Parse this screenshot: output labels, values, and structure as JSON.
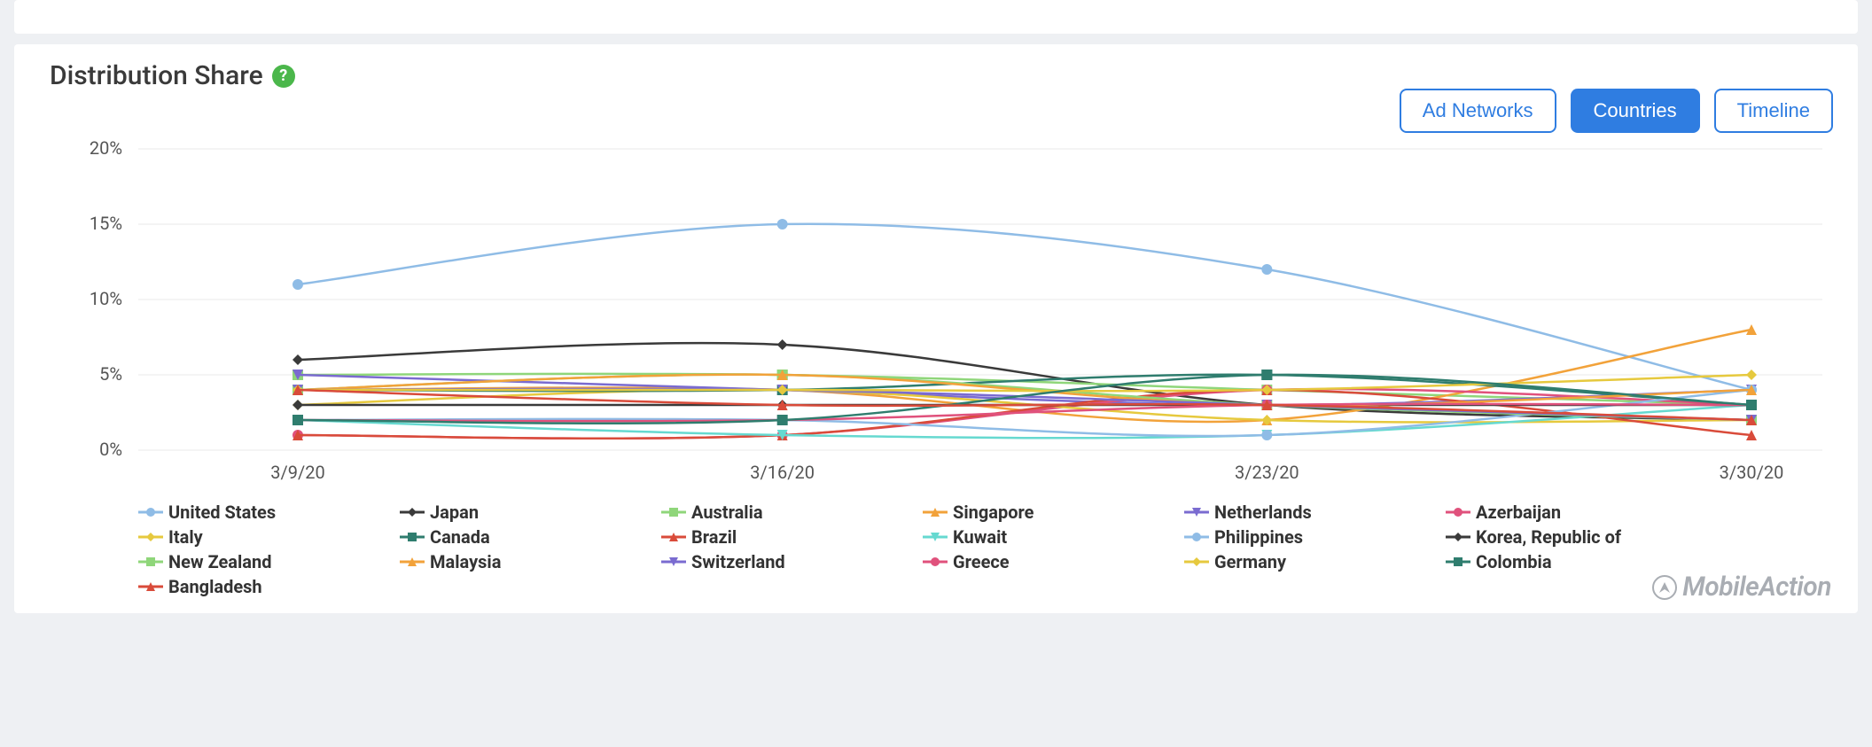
{
  "header": {
    "title": "Distribution Share"
  },
  "buttons": {
    "ad_networks": "Ad Networks",
    "countries": "Countries",
    "timeline": "Timeline"
  },
  "brand": "MobileAction",
  "chart_data": {
    "type": "line",
    "title": "Distribution Share",
    "xlabel": "",
    "ylabel": "",
    "ylim": [
      0,
      20
    ],
    "y_ticks": [
      0,
      5,
      10,
      15,
      20
    ],
    "y_tick_labels": [
      "0%",
      "5%",
      "10%",
      "15%",
      "20%"
    ],
    "categories": [
      "3/9/20",
      "3/16/20",
      "3/23/20",
      "3/30/20"
    ],
    "series": [
      {
        "name": "United States",
        "color": "#8fbce6",
        "marker": "circle",
        "values": [
          11,
          15,
          12,
          4
        ]
      },
      {
        "name": "Japan",
        "color": "#3a3a3a",
        "marker": "diamond",
        "values": [
          6,
          7,
          3,
          2
        ]
      },
      {
        "name": "Australia",
        "color": "#8fd67a",
        "marker": "square",
        "values": [
          5,
          5,
          4,
          3
        ]
      },
      {
        "name": "Singapore",
        "color": "#f2a23a",
        "marker": "triangle-up",
        "values": [
          4,
          4,
          2,
          8
        ]
      },
      {
        "name": "Netherlands",
        "color": "#7a6bd0",
        "marker": "triangle-down",
        "values": [
          5,
          4,
          3,
          4
        ]
      },
      {
        "name": "Azerbaijan",
        "color": "#e0517c",
        "marker": "circle",
        "values": [
          1,
          1,
          4,
          3
        ]
      },
      {
        "name": "Italy",
        "color": "#e6c93e",
        "marker": "diamond",
        "values": [
          3,
          4,
          2,
          2
        ]
      },
      {
        "name": "Canada",
        "color": "#2f7d6e",
        "marker": "square",
        "values": [
          4,
          4,
          5,
          3
        ]
      },
      {
        "name": "Brazil",
        "color": "#d94b3a",
        "marker": "triangle-up",
        "values": [
          1,
          1,
          4,
          1
        ]
      },
      {
        "name": "Kuwait",
        "color": "#66d9d0",
        "marker": "triangle-down",
        "values": [
          2,
          1,
          1,
          3
        ]
      },
      {
        "name": "Philippines",
        "color": "#8fbce6",
        "marker": "circle",
        "values": [
          2,
          2,
          1,
          4
        ]
      },
      {
        "name": "Korea, Republic of",
        "color": "#3a3a3a",
        "marker": "diamond",
        "values": [
          3,
          3,
          3,
          3
        ]
      },
      {
        "name": "New Zealand",
        "color": "#8fd67a",
        "marker": "square",
        "values": [
          4,
          5,
          3,
          2
        ]
      },
      {
        "name": "Malaysia",
        "color": "#f2a23a",
        "marker": "triangle-up",
        "values": [
          4,
          5,
          3,
          4
        ]
      },
      {
        "name": "Switzerland",
        "color": "#7a6bd0",
        "marker": "triangle-down",
        "values": [
          4,
          4,
          3,
          2
        ]
      },
      {
        "name": "Greece",
        "color": "#e0517c",
        "marker": "circle",
        "values": [
          2,
          2,
          3,
          3
        ]
      },
      {
        "name": "Germany",
        "color": "#e6c93e",
        "marker": "diamond",
        "values": [
          4,
          4,
          4,
          5
        ]
      },
      {
        "name": "Colombia",
        "color": "#2f7d6e",
        "marker": "square",
        "values": [
          2,
          2,
          5,
          3
        ]
      },
      {
        "name": "Bangladesh",
        "color": "#d94b3a",
        "marker": "triangle-up",
        "values": [
          4,
          3,
          3,
          2
        ]
      }
    ]
  }
}
